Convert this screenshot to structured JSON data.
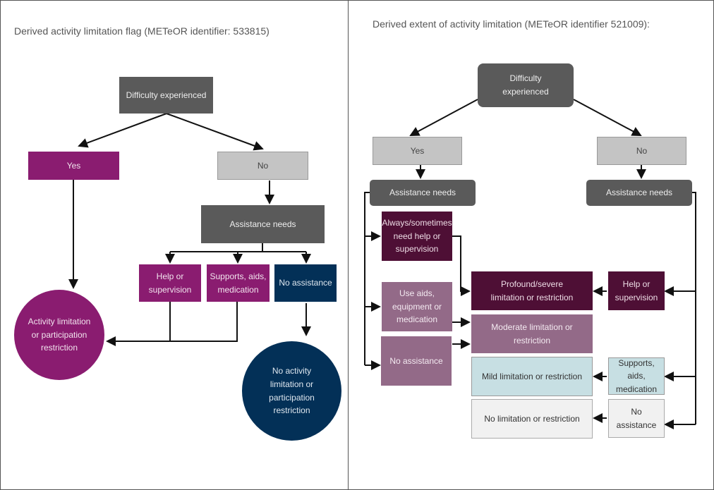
{
  "left_panel": {
    "title": "Derived activity limitation flag (METeOR identifier: 533815)",
    "nodes": {
      "difficulty": "Difficulty experienced",
      "yes": "Yes",
      "no": "No",
      "assistance": "Assistance needs",
      "help": "Help or supervision",
      "supports": "Supports, aids, medication",
      "no_assistance": "No assistance",
      "limitation": "Activity limitation or participation restriction",
      "no_limitation": "No activity limitation or participation restriction"
    }
  },
  "right_panel": {
    "title": "Derived extent of activity limitation (METeOR identifier 521009):",
    "nodes": {
      "difficulty": "Difficulty experienced",
      "yes": "Yes",
      "no": "No",
      "assistance_yes": "Assistance needs",
      "assistance_no": "Assistance needs",
      "always_help": "Always/sometimes need help or supervision",
      "use_aids": "Use aids, equipment or medication",
      "no_assistance_yes": "No assistance",
      "profound": "Profound/severe limitation or restriction",
      "moderate": "Moderate limitation or restriction",
      "mild": "Mild limitation or restriction",
      "none": "No limitation or restriction",
      "help_no": "Help or supervision",
      "supports_no": "Supports, aids, medication",
      "no_assistance_no": "No assistance"
    }
  },
  "colors": {
    "dark_gray": "#5a5a5a",
    "light_gray": "#c4c4c4",
    "purple": "#8a1c70",
    "navy": "#033057",
    "plum_dark": "#4e0f35",
    "plum_light": "#936a88",
    "light_blue": "#c7dfe3",
    "off_white": "#f1f1f1"
  }
}
